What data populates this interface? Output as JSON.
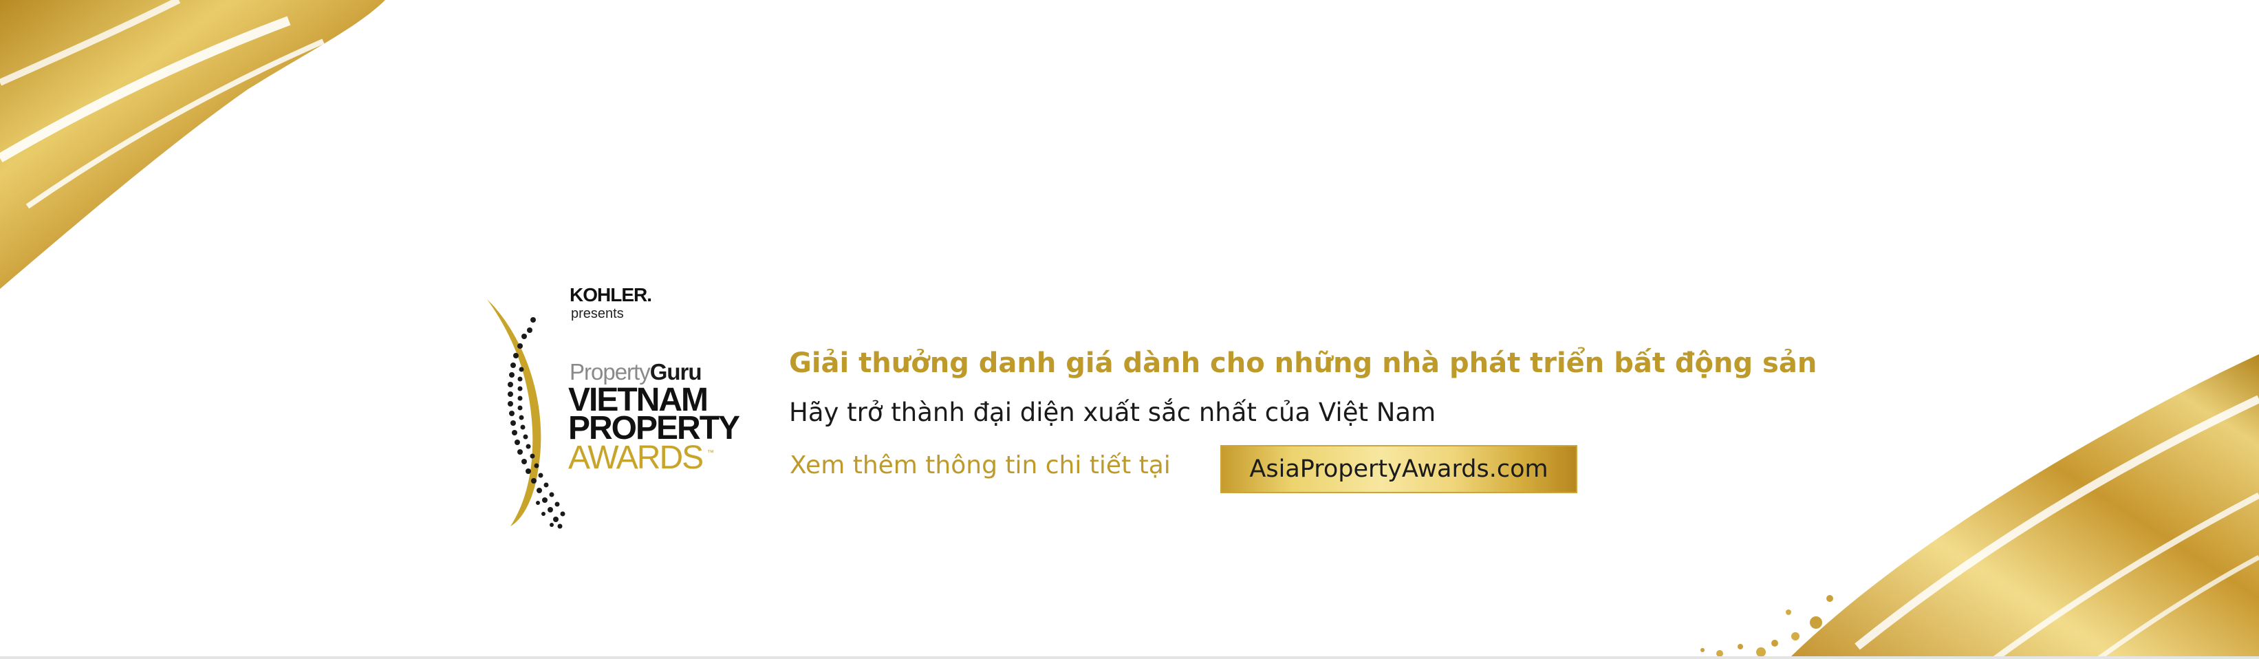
{
  "logo": {
    "sponsor": "KOHLER.",
    "presents": "presents",
    "brand_part1": "Property",
    "brand_part2": "Guru",
    "title_line1": "VIETNAM",
    "title_line2": "PROPERTY",
    "title_line3": "AWARDS",
    "trademark": "™"
  },
  "content": {
    "headline": "Giải thưởng danh giá dành cho những nhà phát triển bất động sản",
    "subline": "Hãy trở thành đại diện xuất sắc nhất của Việt Nam",
    "more_info": "Xem thêm thông tin chi tiết tại",
    "url_label": "AsiaPropertyAwards.com"
  },
  "colors": {
    "gold": "#bd9a2a",
    "dark_text": "#1a1a1a",
    "background": "#ffffff"
  }
}
